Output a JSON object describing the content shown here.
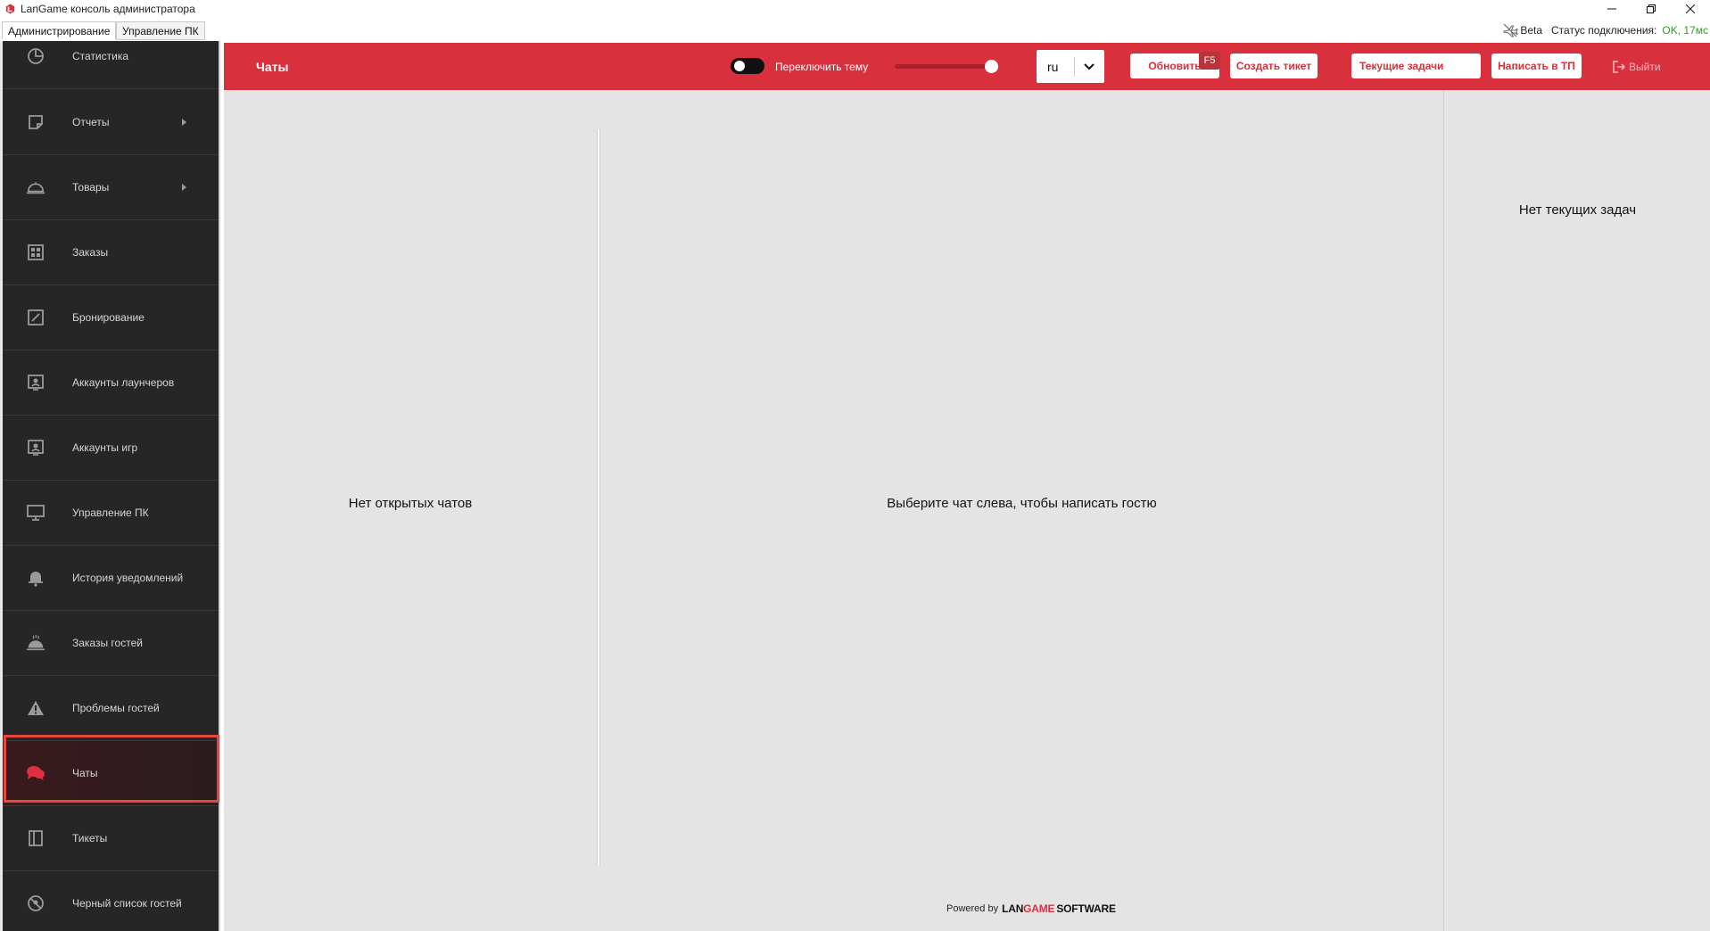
{
  "window": {
    "title": "LanGame консоль администратора",
    "controls": [
      "minimize",
      "restore",
      "close"
    ]
  },
  "window_tabs": [
    {
      "label": "Администрирование",
      "active": true
    },
    {
      "label": "Управление ПК",
      "active": false
    }
  ],
  "status": {
    "beta": "Beta",
    "connection_label": "Статус подключения:",
    "connection_value": "OK, 17мс"
  },
  "sidebar": {
    "items": [
      {
        "label": "Статистика",
        "icon": "pie-chart-icon",
        "submenu": false
      },
      {
        "label": "Отчеты",
        "icon": "report-icon",
        "submenu": true
      },
      {
        "label": "Товары",
        "icon": "cloche-icon",
        "submenu": true
      },
      {
        "label": "Заказы",
        "icon": "grid-icon",
        "submenu": false
      },
      {
        "label": "Бронирование",
        "icon": "edit-icon",
        "submenu": false
      },
      {
        "label": "Аккаунты лаунчеров",
        "icon": "account-icon",
        "submenu": false
      },
      {
        "label": "Аккаунты игр",
        "icon": "account-icon",
        "submenu": false
      },
      {
        "label": "Управление ПК",
        "icon": "monitor-icon",
        "submenu": false
      },
      {
        "label": "История уведомлений",
        "icon": "bell-icon",
        "submenu": false
      },
      {
        "label": "Заказы гостей",
        "icon": "cloche-hot-icon",
        "submenu": false
      },
      {
        "label": "Проблемы гостей",
        "icon": "warning-icon",
        "submenu": false
      },
      {
        "label": "Чаты",
        "icon": "chat-icon",
        "submenu": false,
        "active": true
      },
      {
        "label": "Тикеты",
        "icon": "ticket-icon",
        "submenu": false
      },
      {
        "label": "Черный список гостей",
        "icon": "blocked-icon",
        "submenu": false
      }
    ]
  },
  "header": {
    "title": "Чаты",
    "theme_toggle_label": "Переключить тему",
    "language": "ru",
    "refresh_label": "Обновить",
    "refresh_shortcut": "F5",
    "create_ticket_label": "Создать тикет",
    "current_tasks_label": "Текущие задачи",
    "write_support_label": "Написать в ТП",
    "logout_label": "Выйти"
  },
  "main": {
    "no_chats": "Нет открытых чатов",
    "select_chat": "Выберите чат слева, чтобы написать гостю",
    "no_tasks": "Нет текущих задач",
    "powered_by": "Powered by",
    "brand_lan": "LAN",
    "brand_game": "GAME",
    "brand_software": "SOFTWARE"
  },
  "colors": {
    "accent": "#d9303e",
    "sidebar_bg": "#262626",
    "content_bg": "#e4e4e4",
    "status_ok": "#2f9a2f"
  }
}
